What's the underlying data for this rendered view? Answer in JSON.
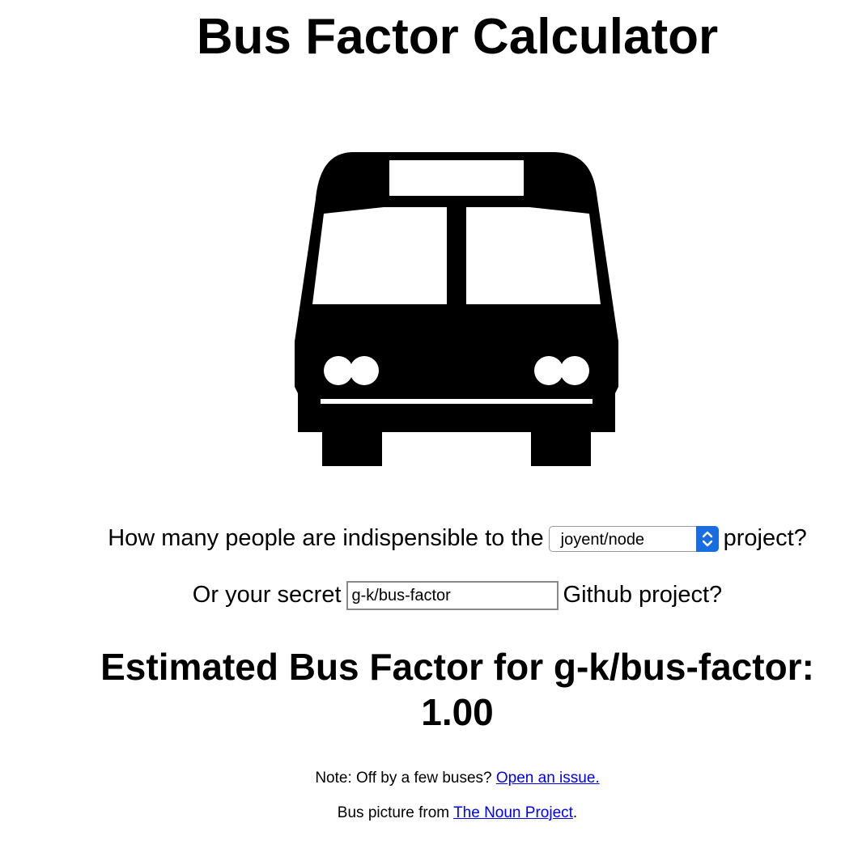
{
  "title": "Bus Factor Calculator",
  "bus_picture": {
    "icon": "bus-icon"
  },
  "question": {
    "prefix": "How many people are indispensible to the",
    "selected_project": "joyent/node",
    "suffix": "project?"
  },
  "secret": {
    "prefix": "Or your secret",
    "input_value": "g-k/bus-factor",
    "suffix": "Github project?"
  },
  "result": {
    "label": "Estimated Bus Factor for g-k/bus-factor:",
    "value": "1.00"
  },
  "note": {
    "text": "Note: Off by a few buses?",
    "link_text": "Open an issue."
  },
  "credit": {
    "text": "Bus picture from",
    "link_text": "The Noun Project",
    "suffix": "."
  },
  "colors": {
    "link": "#0000ee",
    "select_accent": "#1a6de0",
    "text": "#000000",
    "background": "#ffffff"
  }
}
